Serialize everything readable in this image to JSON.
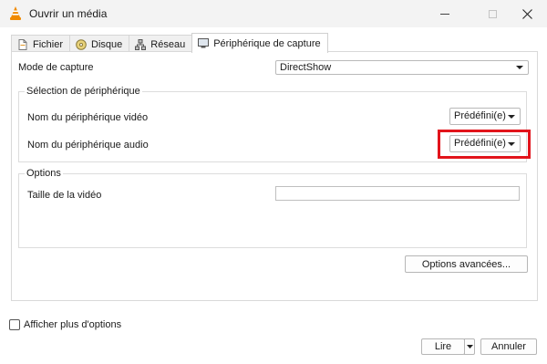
{
  "window": {
    "title": "Ouvrir un média"
  },
  "tabs": [
    {
      "label": "Fichier",
      "icon": "file-icon"
    },
    {
      "label": "Disque",
      "icon": "disc-icon"
    },
    {
      "label": "Réseau",
      "icon": "network-icon"
    },
    {
      "label": "Périphérique de capture",
      "icon": "capture-device-icon",
      "active": true
    }
  ],
  "capture": {
    "mode_label": "Mode de capture",
    "mode_value": "DirectShow"
  },
  "device_selection": {
    "title": "Sélection de périphérique",
    "video_label": "Nom du périphérique vidéo",
    "video_value": "Prédéfini(e)",
    "audio_label": "Nom du périphérique audio",
    "audio_value": "Prédéfini(e)"
  },
  "options": {
    "title": "Options",
    "video_size_label": "Taille de la vidéo",
    "video_size_value": "",
    "advanced_button": "Options avancées..."
  },
  "footer": {
    "show_more_label": "Afficher plus d'options",
    "play_button": "Lire",
    "cancel_button": "Annuler"
  },
  "colors": {
    "highlight": "#e2141b",
    "vlc_orange": "#f08a00"
  }
}
